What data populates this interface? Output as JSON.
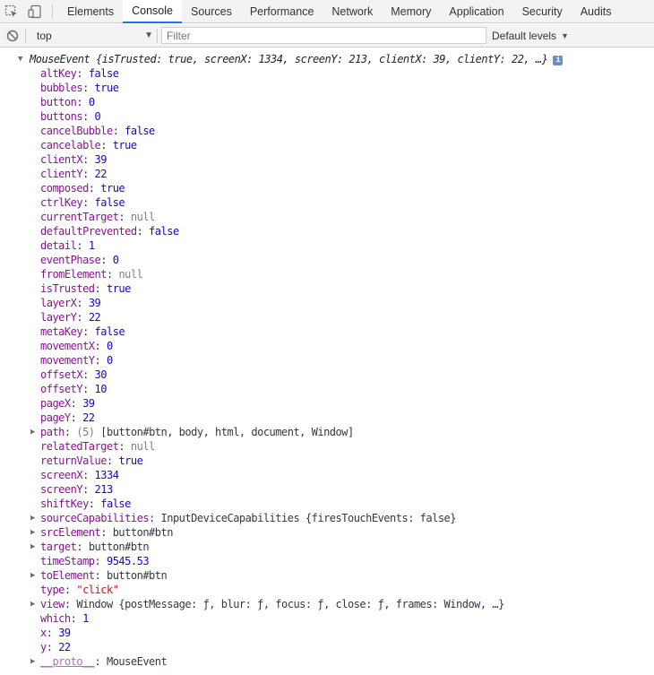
{
  "tabs": [
    "Elements",
    "Console",
    "Sources",
    "Performance",
    "Network",
    "Memory",
    "Application",
    "Security",
    "Audits"
  ],
  "toolbar": {
    "context_value": "top",
    "filter_placeholder": "Filter",
    "levels_label": "Default levels"
  },
  "summary": {
    "text": "MouseEvent {isTrusted: true, screenX: 1334, screenY: 213, clientX: 39, clientY: 22, …}",
    "info_badge": "i"
  },
  "properties": [
    {
      "key": "altKey",
      "value": "false",
      "type": "bool",
      "expandable": false
    },
    {
      "key": "bubbles",
      "value": "true",
      "type": "bool",
      "expandable": false
    },
    {
      "key": "button",
      "value": "0",
      "type": "num",
      "expandable": false
    },
    {
      "key": "buttons",
      "value": "0",
      "type": "num",
      "expandable": false
    },
    {
      "key": "cancelBubble",
      "value": "false",
      "type": "bool",
      "expandable": false
    },
    {
      "key": "cancelable",
      "value": "true",
      "type": "bool",
      "expandable": false
    },
    {
      "key": "clientX",
      "value": "39",
      "type": "num",
      "expandable": false
    },
    {
      "key": "clientY",
      "value": "22",
      "type": "num",
      "expandable": false
    },
    {
      "key": "composed",
      "value": "true",
      "type": "bool",
      "expandable": false
    },
    {
      "key": "ctrlKey",
      "value": "false",
      "type": "bool",
      "expandable": false
    },
    {
      "key": "currentTarget",
      "value": "null",
      "type": "null",
      "expandable": false
    },
    {
      "key": "defaultPrevented",
      "value": "false",
      "type": "bool",
      "expandable": false
    },
    {
      "key": "detail",
      "value": "1",
      "type": "num",
      "expandable": false
    },
    {
      "key": "eventPhase",
      "value": "0",
      "type": "num",
      "expandable": false
    },
    {
      "key": "fromElement",
      "value": "null",
      "type": "null",
      "expandable": false
    },
    {
      "key": "isTrusted",
      "value": "true",
      "type": "bool",
      "expandable": false
    },
    {
      "key": "layerX",
      "value": "39",
      "type": "num",
      "expandable": false
    },
    {
      "key": "layerY",
      "value": "22",
      "type": "num",
      "expandable": false
    },
    {
      "key": "metaKey",
      "value": "false",
      "type": "bool",
      "expandable": false
    },
    {
      "key": "movementX",
      "value": "0",
      "type": "num",
      "expandable": false
    },
    {
      "key": "movementY",
      "value": "0",
      "type": "num",
      "expandable": false
    },
    {
      "key": "offsetX",
      "value": "30",
      "type": "num",
      "expandable": false
    },
    {
      "key": "offsetY",
      "value": "10",
      "type": "num",
      "expandable": false
    },
    {
      "key": "pageX",
      "value": "39",
      "type": "num",
      "expandable": false
    },
    {
      "key": "pageY",
      "value": "22",
      "type": "num",
      "expandable": false
    },
    {
      "key": "path",
      "value": "(5) [button#btn, body, html, document, Window]",
      "type": "path",
      "expandable": true
    },
    {
      "key": "relatedTarget",
      "value": "null",
      "type": "null",
      "expandable": false
    },
    {
      "key": "returnValue",
      "value": "true",
      "type": "bool",
      "expandable": false
    },
    {
      "key": "screenX",
      "value": "1334",
      "type": "num",
      "expandable": false
    },
    {
      "key": "screenY",
      "value": "213",
      "type": "num",
      "expandable": false
    },
    {
      "key": "shiftKey",
      "value": "false",
      "type": "bool",
      "expandable": false
    },
    {
      "key": "sourceCapabilities",
      "value": "InputDeviceCapabilities {firesTouchEvents: false}",
      "type": "obj",
      "expandable": true
    },
    {
      "key": "srcElement",
      "value": "button#btn",
      "type": "obj",
      "expandable": true
    },
    {
      "key": "target",
      "value": "button#btn",
      "type": "obj",
      "expandable": true
    },
    {
      "key": "timeStamp",
      "value": "9545.53",
      "type": "num",
      "expandable": false
    },
    {
      "key": "toElement",
      "value": "button#btn",
      "type": "obj",
      "expandable": true
    },
    {
      "key": "type",
      "value": "\"click\"",
      "type": "str",
      "expandable": false
    },
    {
      "key": "view",
      "value": "Window {postMessage: ƒ, blur: ƒ, focus: ƒ, close: ƒ, frames: Window, …}",
      "type": "obj",
      "expandable": true
    },
    {
      "key": "which",
      "value": "1",
      "type": "num",
      "expandable": false
    },
    {
      "key": "x",
      "value": "39",
      "type": "num",
      "expandable": false
    },
    {
      "key": "y",
      "value": "22",
      "type": "num",
      "expandable": false
    },
    {
      "key": "__proto__",
      "value": "MouseEvent",
      "type": "obj",
      "expandable": true
    }
  ]
}
